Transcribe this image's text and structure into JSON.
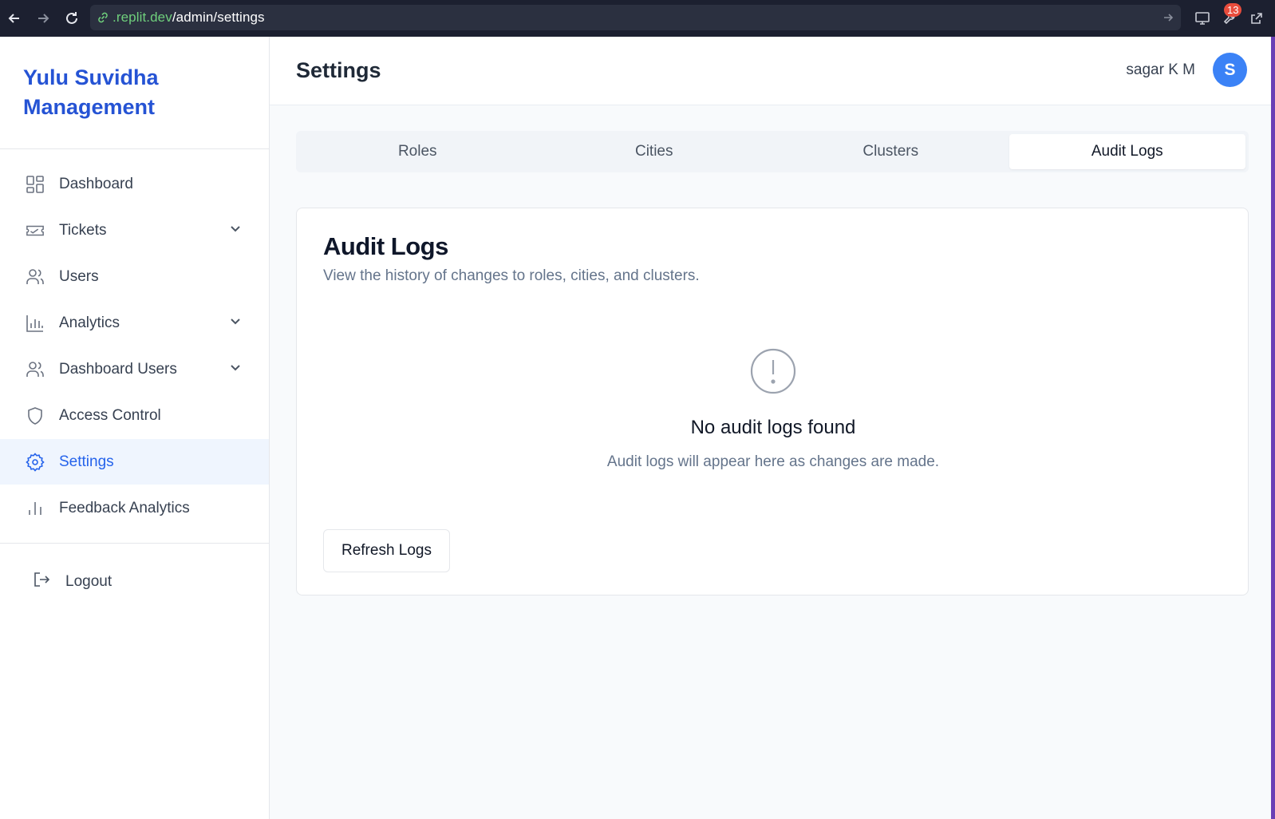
{
  "browser": {
    "url_prefix": ".replit.dev",
    "url_path": "/admin/settings",
    "badge_count": "13"
  },
  "sidebar": {
    "brand": "Yulu Suvidha Management",
    "items": [
      {
        "label": "Dashboard",
        "icon": "dashboard-grid-icon",
        "has_chevron": false
      },
      {
        "label": "Tickets",
        "icon": "ticket-icon",
        "has_chevron": true
      },
      {
        "label": "Users",
        "icon": "users-icon",
        "has_chevron": false
      },
      {
        "label": "Analytics",
        "icon": "bar-chart-icon",
        "has_chevron": true
      },
      {
        "label": "Dashboard Users",
        "icon": "users-icon",
        "has_chevron": true
      },
      {
        "label": "Access Control",
        "icon": "shield-icon",
        "has_chevron": false
      },
      {
        "label": "Settings",
        "icon": "gear-icon",
        "has_chevron": false,
        "active": true
      },
      {
        "label": "Feedback Analytics",
        "icon": "bar-chart-icon",
        "has_chevron": false
      }
    ],
    "logout_label": "Logout"
  },
  "header": {
    "title": "Settings",
    "user_name": "sagar K M",
    "avatar_initial": "S"
  },
  "tabs": [
    {
      "label": "Roles"
    },
    {
      "label": "Cities"
    },
    {
      "label": "Clusters"
    },
    {
      "label": "Audit Logs",
      "active": true
    }
  ],
  "card": {
    "title": "Audit Logs",
    "description": "View the history of changes to roles, cities, and clusters.",
    "empty_title": "No audit logs found",
    "empty_subtitle": "Audit logs will appear here as changes are made.",
    "refresh_label": "Refresh Logs"
  },
  "colors": {
    "accent": "#2563eb",
    "brand": "#2553d4",
    "avatar": "#3b82f6",
    "active_bg": "#eff5fe"
  }
}
